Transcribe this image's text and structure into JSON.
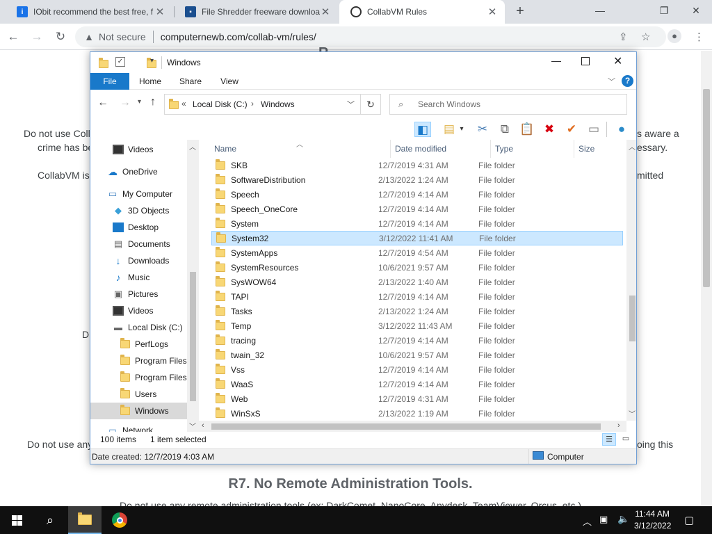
{
  "browser": {
    "tabs": [
      {
        "title": "IObit recommend the best free, f",
        "icon": "iobit-icon"
      },
      {
        "title": "File Shredder freeware download",
        "icon": "shredder-icon"
      },
      {
        "title": "CollabVM Rules",
        "icon": "collabvm-icon",
        "active": true
      }
    ],
    "new_tab": "+",
    "security_label": "Not secure",
    "url": "computernewb.com/collab-vm/rules/"
  },
  "webpage": {
    "line1_left": "Do not use Coll",
    "line1_right": "s aware a",
    "line2_left": "crime has be",
    "line2_right": "essary.",
    "line3_left": "CollabVM is",
    "line3_right": "mitted",
    "line4_left": "D",
    "line5_left": "Do not use any",
    "line5_right": "oing this",
    "heading_r7": "R7. No Remote Administration Tools.",
    "line6": "Do not use any remote administration tools (ex: DarkComet, NanoCore, Anydesk, TeamViewer, Orcus, etc.)",
    "top_partial": "R"
  },
  "explorer": {
    "title": "Windows",
    "ribbon_tabs": [
      "File",
      "Home",
      "Share",
      "View"
    ],
    "breadcrumb_prefix": "«",
    "breadcrumb": [
      "Local Disk (C:)",
      "Windows"
    ],
    "search_placeholder": "Search Windows",
    "nav_items": [
      {
        "label": "Videos",
        "icon": "videos-icon"
      },
      {
        "label": "OneDrive",
        "icon": "onedrive-icon"
      },
      {
        "label": "My Computer",
        "icon": "computer-icon"
      },
      {
        "label": "3D Objects",
        "icon": "3d-objects-icon"
      },
      {
        "label": "Desktop",
        "icon": "desktop-icon"
      },
      {
        "label": "Documents",
        "icon": "documents-icon"
      },
      {
        "label": "Downloads",
        "icon": "downloads-icon"
      },
      {
        "label": "Music",
        "icon": "music-icon"
      },
      {
        "label": "Pictures",
        "icon": "pictures-icon"
      },
      {
        "label": "Videos",
        "icon": "videos-icon"
      },
      {
        "label": "Local Disk (C:)",
        "icon": "drive-icon"
      },
      {
        "label": "PerfLogs",
        "icon": "folder-icon"
      },
      {
        "label": "Program Files",
        "icon": "folder-icon"
      },
      {
        "label": "Program Files (",
        "icon": "folder-icon"
      },
      {
        "label": "Users",
        "icon": "folder-icon"
      },
      {
        "label": "Windows",
        "icon": "folder-icon",
        "selected": true
      },
      {
        "label": "Network",
        "icon": "network-icon"
      }
    ],
    "columns": [
      "Name",
      "Date modified",
      "Type",
      "Size"
    ],
    "files": [
      {
        "name": "SKB",
        "date": "12/7/2019 4:31 AM",
        "type": "File folder"
      },
      {
        "name": "SoftwareDistribution",
        "date": "2/13/2022 1:24 AM",
        "type": "File folder"
      },
      {
        "name": "Speech",
        "date": "12/7/2019 4:14 AM",
        "type": "File folder"
      },
      {
        "name": "Speech_OneCore",
        "date": "12/7/2019 4:14 AM",
        "type": "File folder"
      },
      {
        "name": "System",
        "date": "12/7/2019 4:14 AM",
        "type": "File folder"
      },
      {
        "name": "System32",
        "date": "3/12/2022 11:41 AM",
        "type": "File folder",
        "selected": true
      },
      {
        "name": "SystemApps",
        "date": "12/7/2019 4:54 AM",
        "type": "File folder"
      },
      {
        "name": "SystemResources",
        "date": "10/6/2021 9:57 AM",
        "type": "File folder"
      },
      {
        "name": "SysWOW64",
        "date": "2/13/2022 1:40 AM",
        "type": "File folder"
      },
      {
        "name": "TAPI",
        "date": "12/7/2019 4:14 AM",
        "type": "File folder"
      },
      {
        "name": "Tasks",
        "date": "2/13/2022 1:24 AM",
        "type": "File folder"
      },
      {
        "name": "Temp",
        "date": "3/12/2022 11:43 AM",
        "type": "File folder"
      },
      {
        "name": "tracing",
        "date": "12/7/2019 4:14 AM",
        "type": "File folder"
      },
      {
        "name": "twain_32",
        "date": "10/6/2021 9:57 AM",
        "type": "File folder"
      },
      {
        "name": "Vss",
        "date": "12/7/2019 4:14 AM",
        "type": "File folder"
      },
      {
        "name": "WaaS",
        "date": "12/7/2019 4:14 AM",
        "type": "File folder"
      },
      {
        "name": "Web",
        "date": "12/7/2019 4:31 AM",
        "type": "File folder"
      },
      {
        "name": "WinSxS",
        "date": "2/13/2022 1:19 AM",
        "type": "File folder"
      }
    ],
    "status_count": "100 items",
    "status_selected": "1 item selected",
    "detail_created": "Date created: 12/7/2019 4:03 AM",
    "detail_location": "Computer"
  },
  "taskbar": {
    "time": "11:44 AM",
    "date": "3/12/2022"
  },
  "colors": {
    "accent": "#1979ca",
    "selection": "#cce8ff",
    "folder": "#f8d775"
  }
}
